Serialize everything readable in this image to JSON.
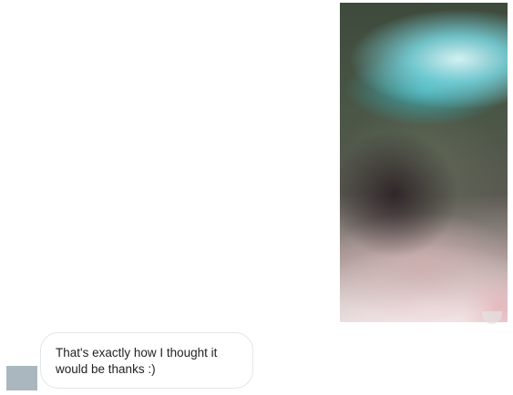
{
  "conversation": {
    "sent_image": {
      "type": "image",
      "description_icon": "blurred-photo"
    },
    "received_message": {
      "text": "That's exactly how I thought it\nwould be thanks :)"
    }
  },
  "colors": {
    "background": "#ffffff",
    "bubble_border": "#e3e6e8",
    "avatar": "#aab7bf",
    "text": "#222222"
  }
}
